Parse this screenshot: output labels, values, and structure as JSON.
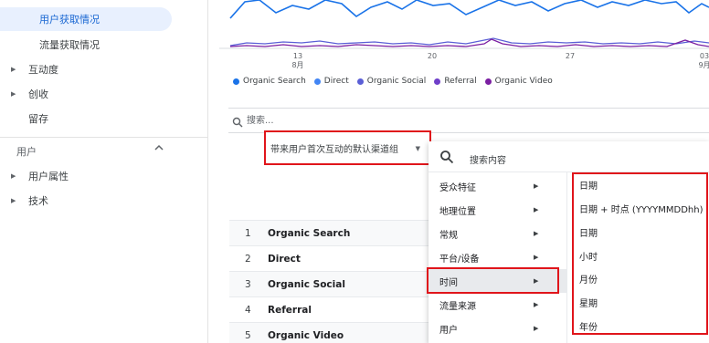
{
  "sidebar": {
    "items": [
      {
        "label": "用户获取情况",
        "active": true
      },
      {
        "label": "流量获取情况"
      },
      {
        "label": "互动度",
        "expandable": true
      },
      {
        "label": "创收",
        "expandable": true
      },
      {
        "label": "留存"
      }
    ],
    "section_title": "用户",
    "section_items": [
      {
        "label": "用户属性",
        "expandable": true
      },
      {
        "label": "技术",
        "expandable": true
      }
    ]
  },
  "chart_data": {
    "type": "line",
    "x_ticks": [
      "13\n8月",
      "20",
      "27",
      "03\n9月"
    ],
    "series": [
      {
        "name": "Organic Search",
        "color": "#1a73e8"
      },
      {
        "name": "Direct",
        "color": "#4285f4"
      },
      {
        "name": "Organic Social",
        "color": "#5b5fd6"
      },
      {
        "name": "Referral",
        "color": "#6f3fc9"
      },
      {
        "name": "Organic Video",
        "color": "#7b1fa2"
      }
    ]
  },
  "chart_ticks": {
    "t1_day": "13",
    "t1_month": "8月",
    "t2": "20",
    "t3": "27",
    "t4_day": "03",
    "t4_month": "9月"
  },
  "search": {
    "placeholder": "搜索..."
  },
  "dimension_selector": {
    "label": "带来用户首次互动的默认渠道组"
  },
  "table": {
    "rows": [
      {
        "index": "1",
        "name": "Organic Search"
      },
      {
        "index": "2",
        "name": "Direct"
      },
      {
        "index": "3",
        "name": "Organic Social"
      },
      {
        "index": "4",
        "name": "Referral"
      },
      {
        "index": "5",
        "name": "Organic Video"
      }
    ]
  },
  "menu": {
    "search_placeholder": "搜索内容",
    "categories": [
      {
        "label": "受众特征"
      },
      {
        "label": "地理位置"
      },
      {
        "label": "常规"
      },
      {
        "label": "平台/设备"
      },
      {
        "label": "时间",
        "highlighted": true
      },
      {
        "label": "流量来源"
      },
      {
        "label": "用户"
      }
    ],
    "sub_items": [
      {
        "label": "日期"
      },
      {
        "label": "日期 + 时点 (YYYYMMDDhh)"
      },
      {
        "label": "日期"
      },
      {
        "label": "小时"
      },
      {
        "label": "月份"
      },
      {
        "label": "星期"
      },
      {
        "label": "年份"
      }
    ]
  },
  "colors": {
    "annotation_red": "#e0151b",
    "accent": "#1967d2"
  }
}
